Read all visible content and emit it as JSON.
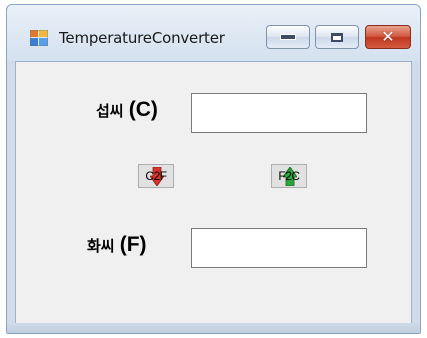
{
  "window": {
    "title": "TemperatureConverter",
    "controls": {
      "minimize": "minimize-icon",
      "maximize": "maximize-icon",
      "close": "close-icon"
    }
  },
  "form": {
    "celsius": {
      "label_ko": "섭씨",
      "label_unit": "(C)",
      "value": ""
    },
    "fahrenheit": {
      "label_ko": "화씨",
      "label_unit": "(F)",
      "value": ""
    },
    "c2f_button": {
      "label": "C2F",
      "icon": "arrow-down-icon",
      "color": "#d9342b"
    },
    "f2c_button": {
      "label": "F2C",
      "icon": "arrow-up-icon",
      "color": "#2aa53a"
    }
  }
}
